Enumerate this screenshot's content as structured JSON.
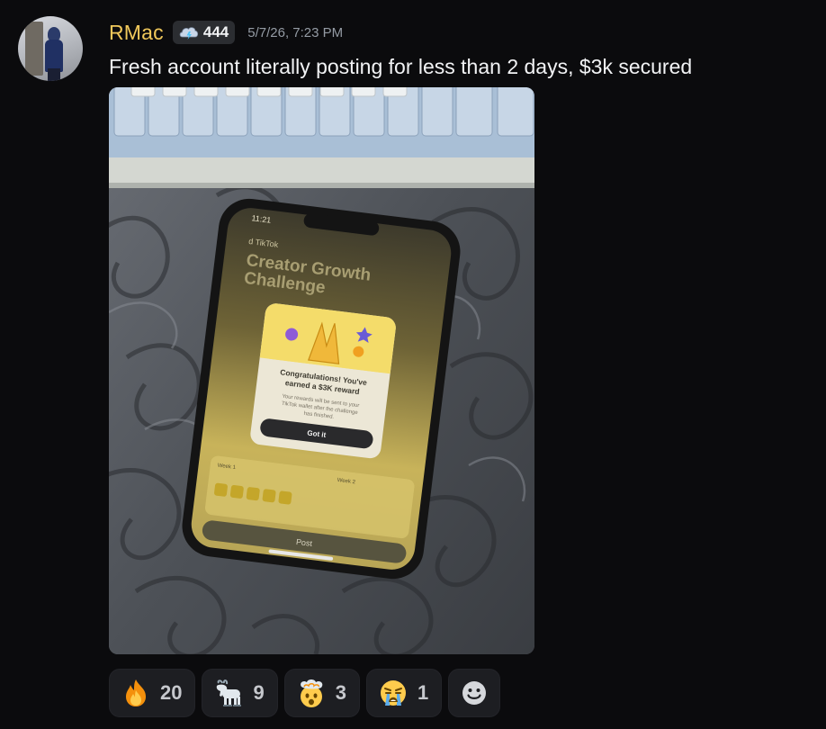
{
  "message": {
    "author": "RMac",
    "server_tag": {
      "icon": "cloud-lightning-icon",
      "label": "444"
    },
    "timestamp": "5/7/26, 7:23 PM",
    "text": "Fresh account literally posting for less than 2 days, $3k secured"
  },
  "attachment": {
    "phone_screen": {
      "clock": "11:21",
      "app_label": "d TikTok",
      "heading_line1": "Creator Growth",
      "heading_line2": "Challenge",
      "modal_title_line1": "Congratulations! You've",
      "modal_title_line2": "earned a $3K reward",
      "modal_body_line1": "Your rewards will be sent to your",
      "modal_body_line2": "TikTok wallet after the challenge",
      "modal_body_line3": "has finished.",
      "modal_button": "Got it",
      "week1_label": "Week 1",
      "week2_label": "Week 2",
      "post_button": "Post"
    }
  },
  "reactions": [
    {
      "emoji": "fire-emoji",
      "count": "20"
    },
    {
      "emoji": "goat-emoji",
      "count": "9"
    },
    {
      "emoji": "exploding-head-emoji",
      "count": "3"
    },
    {
      "emoji": "loudly-crying-face-emoji",
      "count": "1"
    }
  ],
  "add_reaction": {
    "icon": "add-reaction-smiley-icon"
  },
  "colors": {
    "background": "#0b0b0d",
    "username": "#f0c85b",
    "reaction_bg": "#1d1e22",
    "modal_button": "#2a2a2c",
    "screen_yellow": "#f4dc6a"
  }
}
